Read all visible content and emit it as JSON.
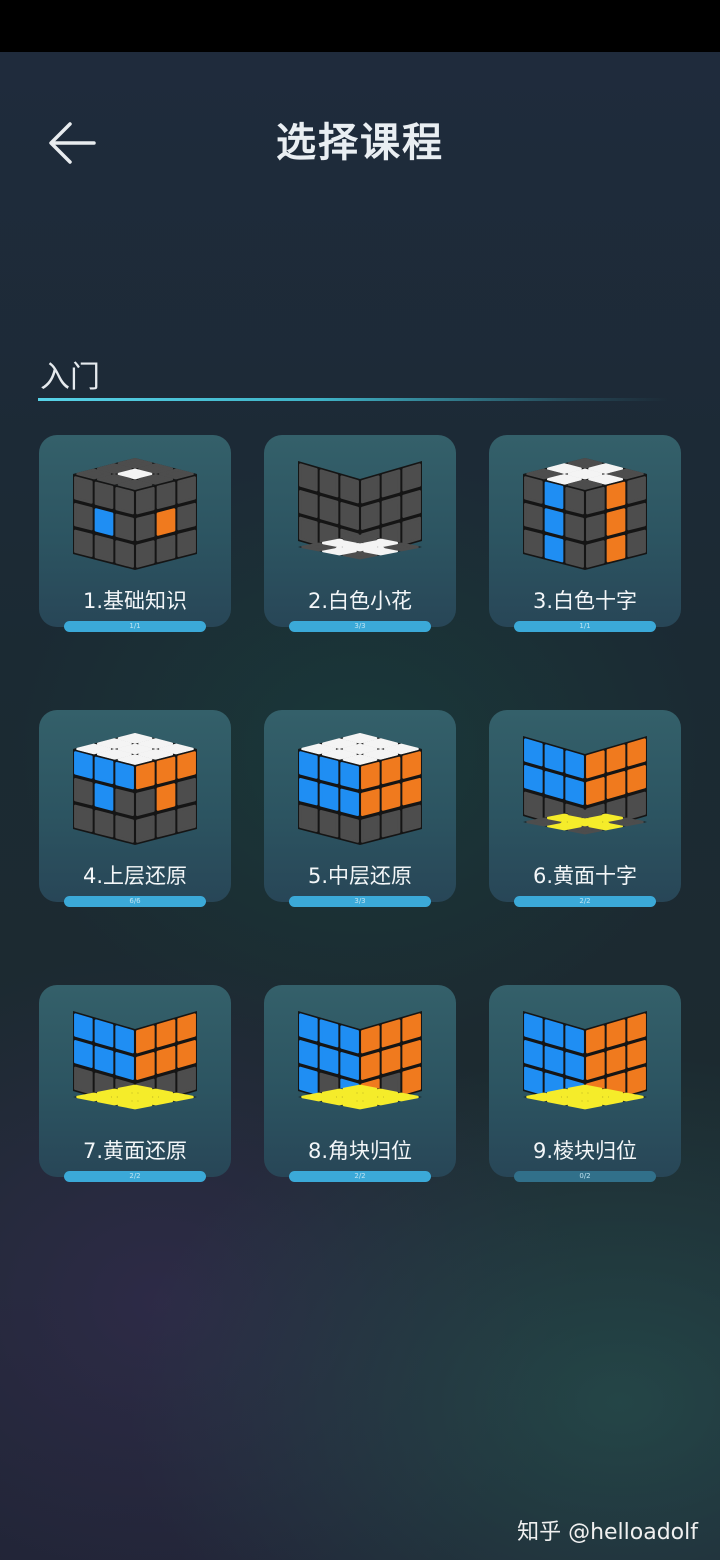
{
  "header": {
    "title": "选择课程",
    "back_icon": "arrow-left-icon"
  },
  "section": {
    "title": "入门"
  },
  "colors": {
    "white": "#f4f4f4",
    "blue": "#1f8ef3",
    "orange": "#f07a1e",
    "yellow": "#f5ec2a",
    "gray": "#4d4d4d",
    "progress": "#3ba9d8"
  },
  "courses": [
    {
      "label": "1.基础知识",
      "progress_text": "1/1",
      "progress": 1.0,
      "cube": "basic"
    },
    {
      "label": "2.白色小花",
      "progress_text": "3/3",
      "progress": 1.0,
      "cube": "white-flower"
    },
    {
      "label": "3.白色十字",
      "progress_text": "1/1",
      "progress": 1.0,
      "cube": "white-cross"
    },
    {
      "label": "4.上层还原",
      "progress_text": "6/6",
      "progress": 1.0,
      "cube": "top-layer"
    },
    {
      "label": "5.中层还原",
      "progress_text": "3/3",
      "progress": 1.0,
      "cube": "middle-layer"
    },
    {
      "label": "6.黄面十字",
      "progress_text": "2/2",
      "progress": 1.0,
      "cube": "yellow-cross"
    },
    {
      "label": "7.黄面还原",
      "progress_text": "2/2",
      "progress": 1.0,
      "cube": "yellow-face"
    },
    {
      "label": "8.角块归位",
      "progress_text": "2/2",
      "progress": 1.0,
      "cube": "corners"
    },
    {
      "label": "9.棱块归位",
      "progress_text": "0/2",
      "progress": 0.0,
      "cube": "edges"
    }
  ],
  "watermark": "知乎 @helloadolf"
}
